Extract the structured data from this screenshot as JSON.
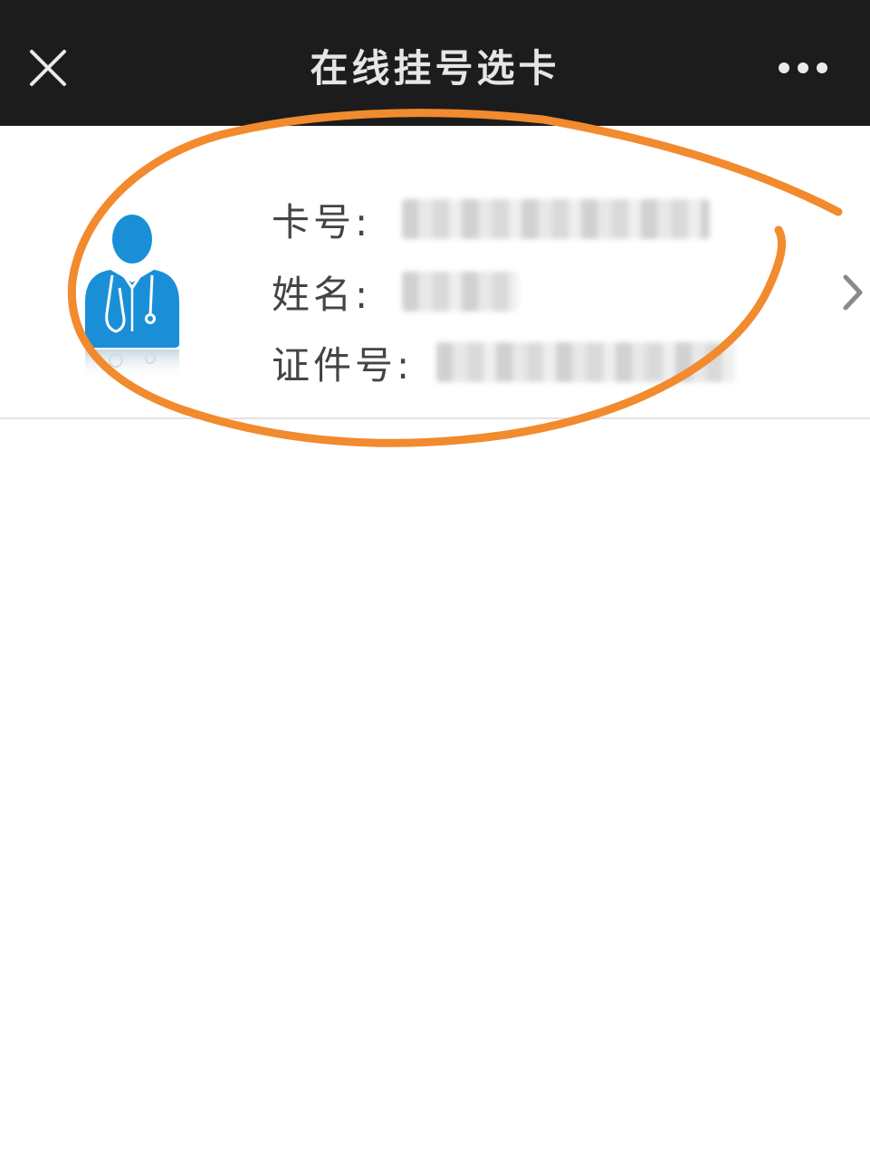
{
  "header": {
    "title": "在线挂号选卡",
    "close_icon": "close-icon",
    "more_icon": "more-dots-icon",
    "background_color": "#1c1c1c"
  },
  "card": {
    "avatar_icon": "doctor-avatar-icon",
    "avatar_color": "#1a8fd8",
    "fields": [
      {
        "label": "卡号:"
      },
      {
        "label": "姓名:"
      },
      {
        "label": "证件号:"
      }
    ],
    "arrow_icon": "chevron-right-icon"
  },
  "annotation": {
    "color": "#f28a2e",
    "shape": "hand-drawn-circle"
  }
}
